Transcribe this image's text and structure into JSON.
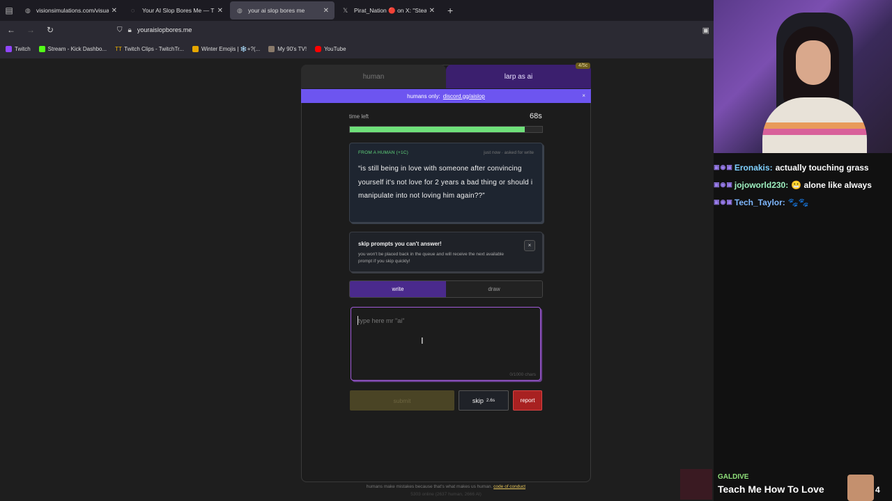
{
  "browser": {
    "tabs": [
      {
        "title": "visionsimulations.com/visual-snow.h",
        "icon": "globe-icon",
        "active": false
      },
      {
        "title": "Your AI Slop Bores Me — The V",
        "icon": "page-icon",
        "active": false
      },
      {
        "title": "your ai slop bores me",
        "icon": "globe-icon",
        "active": true
      },
      {
        "title": "Pirat_Nation 🔴 on X: \"Steam h",
        "icon": "x-logo-icon",
        "active": false
      }
    ],
    "url": "youraislopbores.me",
    "bookmarks": [
      {
        "label": "Twitch",
        "icon": "twitch-icon",
        "color": "#9146ff"
      },
      {
        "label": "Stream - Kick Dashbo...",
        "icon": "kick-icon",
        "color": "#53fc18"
      },
      {
        "label": "Twitch Clips - TwitchTr...",
        "icon": "tt-icon",
        "color": "#f0b400"
      },
      {
        "label": "Winter Emojis | ❄️+?(...",
        "icon": "folder-icon",
        "color": "#e6a700"
      },
      {
        "label": "My 90's TV!",
        "icon": "tv-icon",
        "color": "#8a7a6a"
      },
      {
        "label": "YouTube",
        "icon": "youtube-icon",
        "color": "#ff0000"
      }
    ]
  },
  "app": {
    "tab_human": "human",
    "tab_larp": "larp as ai",
    "counter": "4/5c",
    "banner_prefix": "humans only:",
    "banner_link": "discord.gg/aislop",
    "banner_close": "×",
    "time_left_label": "time left",
    "time_left_value": "68s",
    "progress_fraction": 0.91,
    "prompt": {
      "header": "FROM A HUMAN (+1C)",
      "meta": "just now · asked for write",
      "text": "“is still being in love with someone after convincing yourself it's not love for 2 years a bad thing or should i manipulate into not loving him again??”"
    },
    "skip_notice": {
      "title": "skip prompts you can't answer!",
      "body": "you won't be placed back in the queue and will receive the next available prompt if you skip quickly!",
      "close": "×"
    },
    "mode_write": "write",
    "mode_draw": "draw",
    "textarea_placeholder": "type here mr \"ai\"",
    "char_count": "0/1000 chars",
    "submit_label": "submit",
    "skip_label": "skip",
    "skip_timer": "2.6s",
    "report_label": "report",
    "footer_text": "humans make mistakes because that's what makes us human.",
    "footer_link": "code of conduct",
    "footer_stats": "5303 online (2637 human, 2666 AI)"
  },
  "stream": {
    "chat": [
      {
        "badges": "▣◉▣",
        "user": "Eronakis:",
        "message": "actually touching grass"
      },
      {
        "badges": "▣◉▣",
        "user": "jojoworld230:",
        "message": "😬 alone like always"
      },
      {
        "badges": "▣◉▣",
        "user": "Tech_Taylor:",
        "message": "🐾🐾"
      }
    ],
    "now_playing": {
      "artist": "GALDIVE",
      "title": "Teach Me How To Love",
      "number": "4"
    }
  }
}
